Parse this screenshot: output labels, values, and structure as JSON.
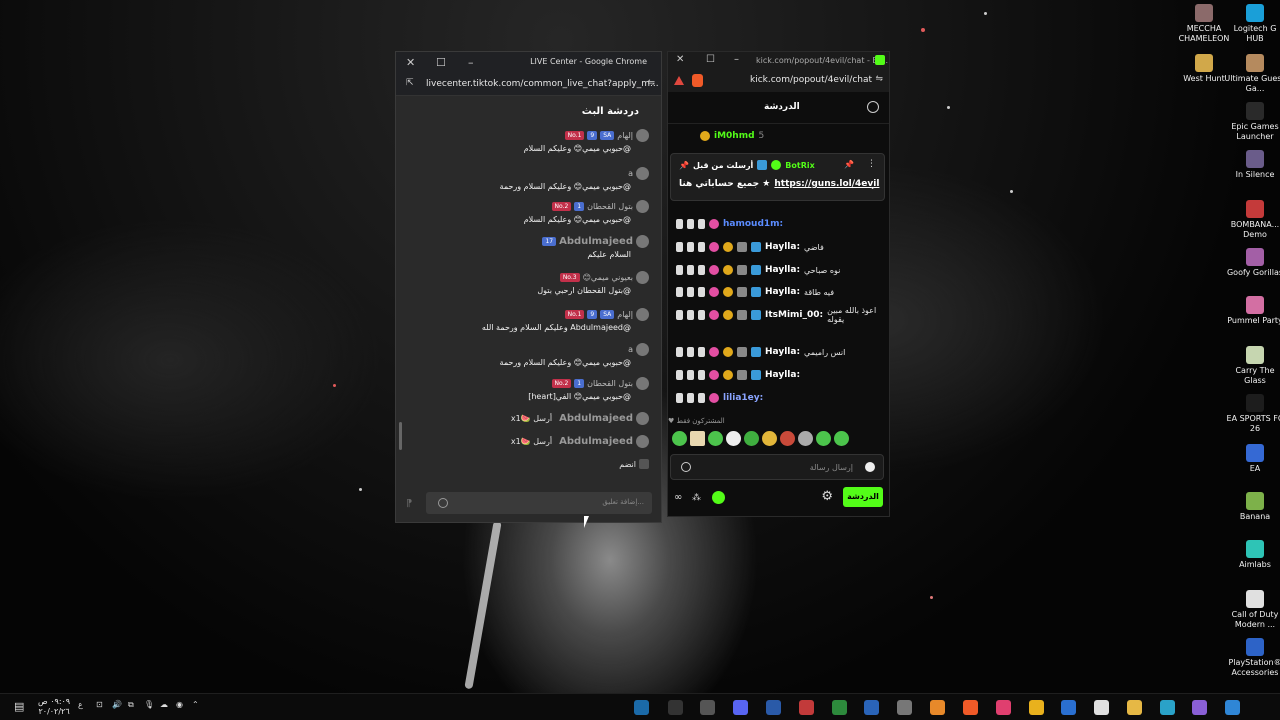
{
  "desktop_icons": [
    {
      "label": "MECCHA CHAMELEON",
      "color": "#8b6a6a"
    },
    {
      "label": "Logitech G HUB",
      "color": "#1a9fd8"
    },
    {
      "label": "West Hunt",
      "color": "#d1a84a"
    },
    {
      "label": "Ultimate Guess Ga...",
      "color": "#b58a5e"
    },
    {
      "label": "Epic Games Launcher",
      "color": "#2a2a2a"
    },
    {
      "label": "In Silence",
      "color": "#6a5c8a"
    },
    {
      "label": "BOMBANA... Demo",
      "color": "#c43a3a"
    },
    {
      "label": "Goofy Gorillas",
      "color": "#a35fa6"
    },
    {
      "label": "Pummel Party",
      "color": "#d36fa3"
    },
    {
      "label": "Carry The Glass",
      "color": "#c6d6b0"
    },
    {
      "label": "EA SPORTS FC 26",
      "color": "#1d1d1d"
    },
    {
      "label": "EA",
      "color": "#3569d4"
    },
    {
      "label": "Banana",
      "color": "#7db14a"
    },
    {
      "label": "Aimlabs",
      "color": "#2ec4b6"
    },
    {
      "label": "Call of Duty Modern ...",
      "color": "#e0e0e0"
    },
    {
      "label": "PlayStation® Accessories",
      "color": "#2d63c7"
    }
  ],
  "tiktok": {
    "window_title": "LIVE Center - Google Chrome",
    "url": "livecenter.tiktok.com/common_live_chat?apply_m...",
    "chat_header": "دردشة البث",
    "messages": [
      {
        "name": "إلهام",
        "badges": [
          "SA",
          "9",
          "No.1"
        ],
        "text": "@حبوبي ميمي😊 وعليكم السلام",
        "big": false
      },
      {
        "name": "a",
        "badges": [],
        "text": "@حبوبي ميمي😊 وعليكم السلام ورحمة",
        "big": false
      },
      {
        "name": "بتول القحطان",
        "badges": [
          "1",
          "No.2"
        ],
        "text": "@حبوبي ميمي😊 وعليكم السلام",
        "big": false
      },
      {
        "name": "Abdulmajeed",
        "badges": [
          "17"
        ],
        "text": "السلام عليكم",
        "big": true
      },
      {
        "name": "بعيوني ميمي😊",
        "badges": [
          "No.3"
        ],
        "text": "@بتول القحطان ارحبي بتول",
        "big": false
      },
      {
        "name": "إلهام",
        "badges": [
          "SA",
          "9",
          "No.1"
        ],
        "text": "@Abdulmajeed وعليكم السلام ورحمة الله",
        "big": false
      },
      {
        "name": "a",
        "badges": [],
        "text": "@حبوبي ميمي😊 وعليكم السلام ورحمة",
        "big": false
      },
      {
        "name": "بتول القحطان",
        "badges": [
          "1",
          "No.2"
        ],
        "text": "@حبوبي ميمي😊 الفي[heart]",
        "big": false
      },
      {
        "name": "Abdulmajeed",
        "badges": [],
        "text": "أرسل 🍉x1",
        "big": true
      },
      {
        "name": "Abdulmajeed",
        "badges": [],
        "text": "أرسل 🍉x1",
        "big": true
      }
    ],
    "joined_text": "انضم",
    "input_placeholder": "إضافة تعليق..."
  },
  "kick": {
    "window_title": "kick.com/popout/4evil/chat - Br...",
    "url": "kick.com/popout/4evil/chat",
    "header": "الدردشة",
    "top_user": "iM0hmd",
    "top_user_count": "5",
    "pinned": {
      "label": "أرسلت من قبل",
      "user": "BotRix",
      "text": "جميع حساباتي هنا ★",
      "link": "https://guns.lol/4evil"
    },
    "messages": [
      {
        "user": "hamoud1m:",
        "text": "",
        "color": "#5b8cff"
      },
      {
        "user": "Haylla:",
        "text": "فاضي",
        "color": "#ffffff"
      },
      {
        "user": "Haylla:",
        "text": "نوه صباحي",
        "color": "#ffffff"
      },
      {
        "user": "Haylla:",
        "text": "فيه طاقة",
        "color": "#ffffff"
      },
      {
        "user": "ItsMimi_00:",
        "text": "اعوذ بالله مبين يقوله",
        "color": "#ffffff"
      },
      {
        "user": "Haylla:",
        "text": "انس راميمي",
        "color": "#ffffff"
      },
      {
        "user": "Haylla:",
        "text": "",
        "color": "#ffffff"
      },
      {
        "user": "lilia1ey:",
        "text": "",
        "color": "#8aa4ff"
      }
    ],
    "subs_only": "المشتركون فقط",
    "input_placeholder": "إرسال رسالة",
    "chat_button": "الدردشة"
  },
  "taskbar": {
    "time": "٠٩:٠٩ ص",
    "date": "٢٠/٠٢/٢٦",
    "lang": "ع"
  }
}
